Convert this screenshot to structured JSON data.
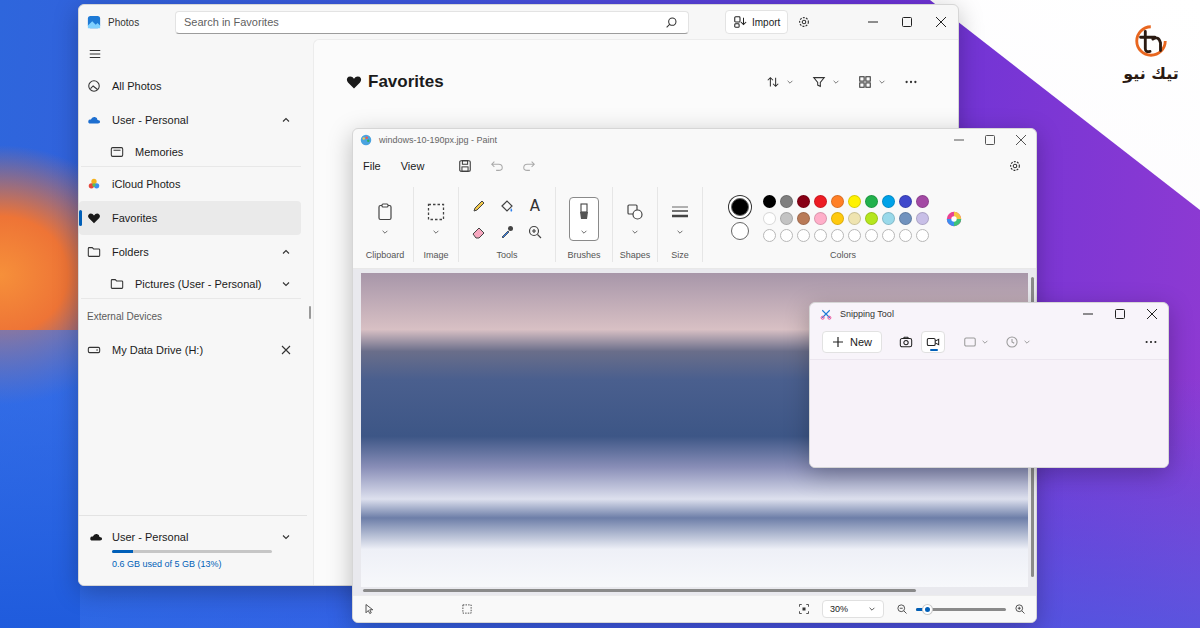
{
  "logo": {
    "text": "تيك نيو"
  },
  "photos": {
    "window": {
      "title": "Photos"
    },
    "search": {
      "placeholder": "Search in Favorites"
    },
    "import_button": "Import",
    "sidebar": {
      "items": [
        {
          "label": "All Photos",
          "kind": "nav",
          "selected": false,
          "expandable": false,
          "expanded": false,
          "removable": false
        },
        {
          "label": "User - Personal",
          "kind": "nav",
          "selected": false,
          "expandable": true,
          "expanded": true,
          "removable": false
        },
        {
          "label": "Memories",
          "kind": "child",
          "selected": false,
          "expandable": false,
          "expanded": false,
          "removable": false
        },
        {
          "label": "iCloud Photos",
          "kind": "nav",
          "selected": false,
          "expandable": false,
          "expanded": false,
          "removable": false
        },
        {
          "label": "Favorites",
          "kind": "nav",
          "selected": true,
          "expandable": false,
          "expanded": false,
          "removable": false
        },
        {
          "label": "Folders",
          "kind": "nav",
          "selected": false,
          "expandable": true,
          "expanded": true,
          "removable": false
        },
        {
          "label": "Pictures (User - Personal)",
          "kind": "child",
          "selected": false,
          "expandable": true,
          "expanded": false,
          "removable": false
        },
        {
          "label": "External Devices",
          "kind": "section",
          "selected": false,
          "expandable": false,
          "expanded": false,
          "removable": false
        },
        {
          "label": "My Data Drive (H:)",
          "kind": "nav",
          "selected": false,
          "expandable": false,
          "expanded": false,
          "removable": true
        }
      ]
    },
    "storage": {
      "account": "User - Personal",
      "expanded": false,
      "level": 0.13,
      "reading": "0.6 GB used of 5 GB (13%)"
    },
    "main": {
      "heading": "Favorites"
    }
  },
  "paint": {
    "window": {
      "title": "windows-10-190px.jpg - Paint"
    },
    "menu": [
      "File",
      "View"
    ],
    "groups": [
      {
        "label": "Clipboard",
        "selected": false
      },
      {
        "label": "Image",
        "selected": false
      },
      {
        "label": "Tools",
        "selected": false
      },
      {
        "label": "Brushes",
        "selected": true
      },
      {
        "label": "Shapes",
        "selected": false
      },
      {
        "label": "Size",
        "selected": false
      },
      {
        "label": "Colors",
        "selected": false
      }
    ],
    "text_tool_glyph": "A",
    "primary_color": "#000000",
    "secondary_color": "#ffffff",
    "palette": [
      {
        "color": "#000000",
        "filled": true
      },
      {
        "color": "#7f7f7f",
        "filled": true
      },
      {
        "color": "#880015",
        "filled": true
      },
      {
        "color": "#ed1c24",
        "filled": true
      },
      {
        "color": "#ff7f27",
        "filled": true
      },
      {
        "color": "#fff200",
        "filled": true
      },
      {
        "color": "#22b14c",
        "filled": true
      },
      {
        "color": "#00a2e8",
        "filled": true
      },
      {
        "color": "#3f48cc",
        "filled": true
      },
      {
        "color": "#a349a4",
        "filled": true
      },
      {
        "color": "#ffffff",
        "filled": true
      },
      {
        "color": "#c3c3c3",
        "filled": true
      },
      {
        "color": "#b97a57",
        "filled": true
      },
      {
        "color": "#ffaec9",
        "filled": true
      },
      {
        "color": "#ffc90e",
        "filled": true
      },
      {
        "color": "#efe4b0",
        "filled": true
      },
      {
        "color": "#b5e61d",
        "filled": true
      },
      {
        "color": "#99d9ea",
        "filled": true
      },
      {
        "color": "#7092be",
        "filled": true
      },
      {
        "color": "#c8bfe7",
        "filled": true
      },
      {
        "color": "#ffffff",
        "filled": false
      },
      {
        "color": "#ffffff",
        "filled": false
      },
      {
        "color": "#ffffff",
        "filled": false
      },
      {
        "color": "#ffffff",
        "filled": false
      },
      {
        "color": "#ffffff",
        "filled": false
      },
      {
        "color": "#ffffff",
        "filled": false
      },
      {
        "color": "#ffffff",
        "filled": false
      },
      {
        "color": "#ffffff",
        "filled": false
      },
      {
        "color": "#ffffff",
        "filled": false
      },
      {
        "color": "#ffffff",
        "filled": false
      }
    ],
    "zoom": {
      "reading": "30%",
      "level": 0.09
    }
  },
  "snip": {
    "window": {
      "title": "Snipping Tool"
    },
    "new_button": "New",
    "modes": [
      {
        "kind": "screenshot",
        "selected": false
      },
      {
        "kind": "record",
        "selected": true
      }
    ],
    "shape_picker": {
      "disabled": true
    },
    "delay_picker": {
      "disabled": true
    }
  }
}
